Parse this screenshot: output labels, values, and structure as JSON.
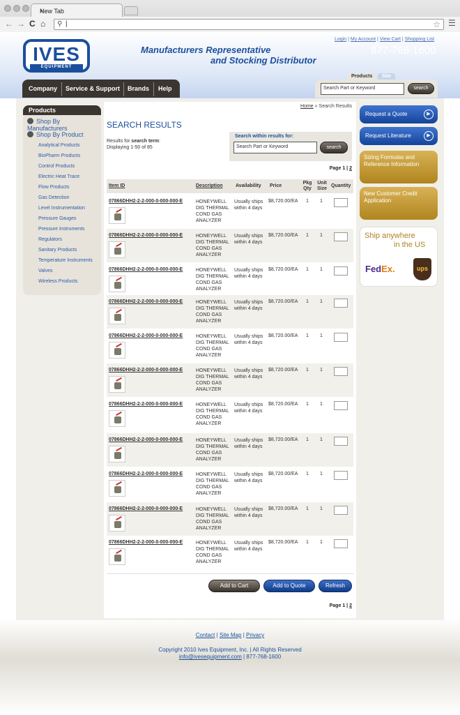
{
  "browser": {
    "tab_title": "New Tab",
    "tab_close": "×",
    "back": "←",
    "forward": "→",
    "reload": "C",
    "home": "⌂",
    "omnibox_value": "|",
    "search_icon": "search-icon",
    "star_icon": "star-icon",
    "menu_icon": "menu-icon"
  },
  "header": {
    "logo_main": "IVES",
    "logo_sub": "EQUIPMENT",
    "tagline_1": "Manufacturers Representative",
    "tagline_2": "and Stocking Distributor",
    "phone": "877-768-1600",
    "top_links": [
      "Login",
      "My Account",
      "View Cart",
      "Shopping List"
    ],
    "nav": [
      "Company",
      "Service & Support",
      "Brands",
      "Help"
    ],
    "search_tabs": [
      "Products",
      "Site"
    ],
    "search_placeholder": "Search Part or Keyword",
    "search_button": "search"
  },
  "sidebar": {
    "title": "Products",
    "categories": [
      "Shop By Manufacturers",
      "Shop By Product"
    ],
    "items": [
      "Analytical Products",
      "BioPharm Products",
      "Control Products",
      "Electric Heat Trace",
      "Flow Products",
      "Gas Detection",
      "Level Instrumentation",
      "Pressure Gauges",
      "Pressure Instruments",
      "Regulators",
      "Sanitary Products",
      "Temperature Instruments",
      "Valves",
      "Wireless Products"
    ]
  },
  "main": {
    "breadcrumb_home": "Home",
    "breadcrumb_sep": "»",
    "breadcrumb_current": "Search Results",
    "title": "SEARCH RESULTS",
    "results_for": "Results for",
    "search_term_label": "search term",
    "colon": ":",
    "displaying": "Displaying 1-50 of 85",
    "search_within_label": "Search within results for:",
    "search_within_placeholder": "Search Part or Keyword",
    "search_within_button": "search",
    "page_label": "Page",
    "page_current": "1",
    "page_sep": "|",
    "page_next": "2",
    "columns": {
      "item_id": "Item ID",
      "description": "Description",
      "availability": "Availability",
      "price": "Price",
      "pkg_qty": "Pkg Qty",
      "unit_size": "Unit Size",
      "quantity": "Quantity"
    },
    "rows": [
      {
        "id": "07866DHH2-2-2-000-0-000-000-E",
        "desc": "HONEYWELL DIG THERMAL COND GAS ANALYZER",
        "avail": "Usually ships within 4 days",
        "price": "$8,720.00/EA",
        "pkg": "1",
        "unit": "1"
      },
      {
        "id": "07866DHH2-2-2-000-0-000-000-E",
        "desc": "HONEYWELL DIG THERMAL COND GAS ANALYZER",
        "avail": "Usually ships within 4 days",
        "price": "$8,720.00/EA",
        "pkg": "1",
        "unit": "1"
      },
      {
        "id": "07866DHH2-2-2-000-0-000-000-E",
        "desc": "HONEYWELL DIG THERMAL COND GAS ANALYZER",
        "avail": "Usually ships within 4 days",
        "price": "$8,720.00/EA",
        "pkg": "1",
        "unit": "1"
      },
      {
        "id": "07866DHH2-2-2-000-0-000-000-E",
        "desc": "HONEYWELL DIG THERMAL COND GAS ANALYZER",
        "avail": "Usually ships within 4 days",
        "price": "$8,720.00/EA",
        "pkg": "1",
        "unit": "1"
      },
      {
        "id": "07866DHH2-2-2-000-0-000-000-E",
        "desc": "HONEYWELL DIG THERMAL COND GAS ANALYZER",
        "avail": "Usually ships within 4 days",
        "price": "$8,720.00/EA",
        "pkg": "1",
        "unit": "1"
      },
      {
        "id": "07866DHH2-2-2-000-0-000-000-E",
        "desc": "HONEYWELL DIG THERMAL COND GAS ANALYZER",
        "avail": "Usually ships within 4 days",
        "price": "$8,720.00/EA",
        "pkg": "1",
        "unit": "1"
      },
      {
        "id": "07866DHH2-2-2-000-0-000-000-E",
        "desc": "HONEYWELL DIG THERMAL COND GAS ANALYZER",
        "avail": "Usually ships within 4 days",
        "price": "$8,720.00/EA",
        "pkg": "1",
        "unit": "1"
      },
      {
        "id": "07866DHH2-2-2-000-0-000-000-E",
        "desc": "HONEYWELL DIG THERMAL COND GAS ANALYZER",
        "avail": "Usually ships within 4 days",
        "price": "$8,720.00/EA",
        "pkg": "1",
        "unit": "1"
      },
      {
        "id": "07866DHH2-2-2-000-0-000-000-E",
        "desc": "HONEYWELL DIG THERMAL COND GAS ANALYZER",
        "avail": "Usually ships within 4 days",
        "price": "$8,720.00/EA",
        "pkg": "1",
        "unit": "1"
      },
      {
        "id": "07866DHH2-2-2-000-0-000-000-E",
        "desc": "HONEYWELL DIG THERMAL COND GAS ANALYZER",
        "avail": "Usually ships within 4 days",
        "price": "$8,720.00/EA",
        "pkg": "1",
        "unit": "1"
      },
      {
        "id": "07866DHH2-2-2-000-0-000-000-E",
        "desc": "HONEYWELL DIG THERMAL COND GAS ANALYZER",
        "avail": "Usually ships within 4 days",
        "price": "$8,720.00/EA",
        "pkg": "1",
        "unit": "1"
      }
    ],
    "buttons": {
      "add_cart": "Add to Cart",
      "add_quote": "Add to Quote",
      "refresh": "Refresh"
    }
  },
  "right": {
    "request_quote": "Request a Quote",
    "request_literature": "Request Literature",
    "arrow": "▶",
    "promo_1": "Sizing Formulas and Reference Information",
    "promo_2": "New Customer Credit Application",
    "ship_text_1": "Ship anywhere",
    "ship_text_2": "in the US",
    "fedex_1": "Fed",
    "fedex_2": "Ex",
    "fedex_dot": ".",
    "ups": "ups"
  },
  "footer": {
    "links": [
      "Contact",
      "Site Map",
      "Privacy"
    ],
    "sep": "|",
    "copyright": "Copyright 2010 Ives Equipment, Inc. | All Rights Reserved",
    "email": "info@ivesequipment.com",
    "phone": "| 877-768-1600"
  },
  "colors": {
    "brand_blue": "#1b4f9c",
    "nav_brown": "#3b3530",
    "promo_gold": "#c99c38"
  }
}
